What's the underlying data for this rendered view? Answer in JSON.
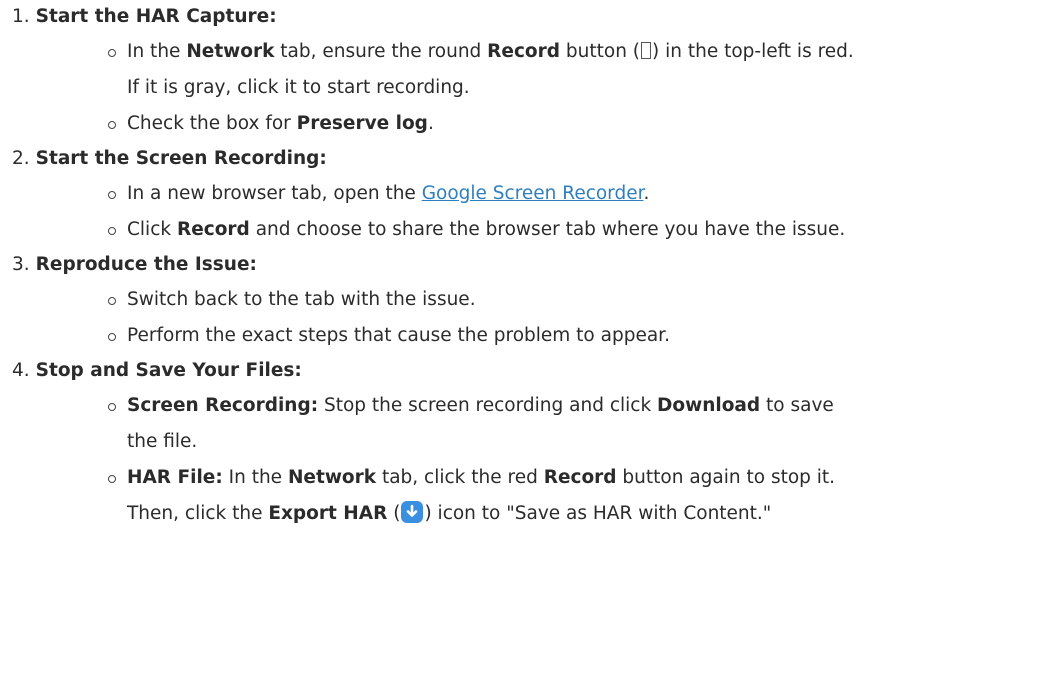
{
  "steps": [
    {
      "number": "1.",
      "title": "Start the HAR Capture:",
      "items": [
        {
          "t1": "In the ",
          "b1": "Network",
          "t2": " tab, ensure the round ",
          "b2": "Record",
          "t3": " button (",
          "t4": ") in the top-left is red.",
          "t5": "If it is gray, click it to start recording."
        },
        {
          "t1": "Check the box for ",
          "b1": "Preserve log",
          "t2": "."
        }
      ]
    },
    {
      "number": "2.",
      "title": "Start the Screen Recording:",
      "items": [
        {
          "t1": "In a new browser tab, open the ",
          "link": "Google Screen Recorder",
          "t2": "."
        },
        {
          "t1": "Click ",
          "b1": "Record",
          "t2": " and choose to share the browser tab where you have the issue."
        }
      ]
    },
    {
      "number": "3.",
      "title": "Reproduce the Issue:",
      "items": [
        {
          "t1": "Switch back to the tab with the issue."
        },
        {
          "t1": "Perform the exact steps that cause the problem to appear."
        }
      ]
    },
    {
      "number": "4.",
      "title": "Stop and Save Your Files:",
      "items": [
        {
          "b1": "Screen Recording:",
          "t1": " Stop the screen recording and click ",
          "b2": "Download",
          "t2": " to save",
          "t3": "the file."
        },
        {
          "b1": "HAR File:",
          "t1": " In the ",
          "b2": "Network",
          "t2": " tab, click the red ",
          "b3": "Record",
          "t3": " button again to stop it.",
          "t4": "Then, click the ",
          "b4": "Export HAR",
          "t5": " (",
          "t6": ") icon to \"Save as HAR with Content.\""
        }
      ]
    }
  ],
  "icons": {
    "record_glyph": "record-glyph-icon",
    "export_har": "export-download-icon",
    "export_color": "#3b8fe0"
  }
}
